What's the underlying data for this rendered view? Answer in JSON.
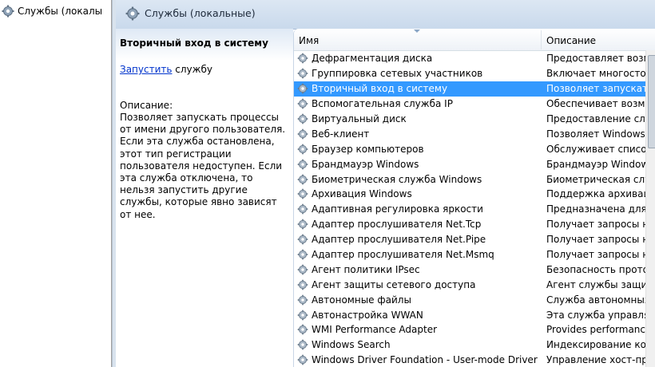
{
  "tree": {
    "root_label": "Службы (локалы"
  },
  "header": {
    "title": "Службы (локальные)"
  },
  "details": {
    "service_title": "Вторичный вход в систему",
    "start_link": "Запустить",
    "start_suffix": " службу",
    "description_label": "Описание:",
    "description_text": "Позволяет запускать процессы от имени другого пользователя. Если эта служба остановлена, этот тип регистрации пользователя недоступен. Если эта служба отключена, то нельзя запустить другие службы, которые явно зависят от нее."
  },
  "columns": {
    "name": "Имя",
    "description": "Описание"
  },
  "services": [
    {
      "name": "Дефрагментация диска",
      "description": "Предоставляет возмож"
    },
    {
      "name": "Группировка сетевых участников",
      "description": "Включает многосторон"
    },
    {
      "name": "Вторичный вход в систему",
      "description": "Позволяет запускать пр",
      "selected": true
    },
    {
      "name": "Вспомогательная служба IP",
      "description": "Обеспечивает возможн"
    },
    {
      "name": "Виртуальный диск",
      "description": "Предоставление служб"
    },
    {
      "name": "Веб-клиент",
      "description": "Позволяет Windows-про"
    },
    {
      "name": "Браузер компьютеров",
      "description": "Обслуживает список ко"
    },
    {
      "name": "Брандмауэр Windows",
      "description": "Брандмауэр Windows п"
    },
    {
      "name": "Биометрическая служба Windows",
      "description": "Биометрическая служба"
    },
    {
      "name": "Архивация Windows",
      "description": "Поддержка архивации и"
    },
    {
      "name": "Адаптивная регулировка яркости",
      "description": "Предназначена для наб"
    },
    {
      "name": "Адаптер прослушивателя Net.Tcp",
      "description": "Получает запросы на а"
    },
    {
      "name": "Адаптер прослушивателя Net.Pipe",
      "description": "Получает запросы на а"
    },
    {
      "name": "Адаптер прослушивателя Net.Msmq",
      "description": "Получает запросы на а"
    },
    {
      "name": "Агент политики IPsec",
      "description": "Безопасность протокол"
    },
    {
      "name": "Агент защиты сетевого доступа",
      "description": "Агент службы защиты с"
    },
    {
      "name": "Автономные файлы",
      "description": "Служба автономных фа"
    },
    {
      "name": "Автонастройка WWAN",
      "description": "Эта служба управляет м"
    },
    {
      "name": "WMI Performance Adapter",
      "description": "Provides performance lib"
    },
    {
      "name": "Windows Search",
      "description": "Индексирование конте"
    },
    {
      "name": "Windows Driver Foundation - User-mode Driver F...",
      "description": "Управление хост-проце"
    }
  ],
  "colors": {
    "selection": "#3399ff",
    "link": "#0033cc"
  }
}
